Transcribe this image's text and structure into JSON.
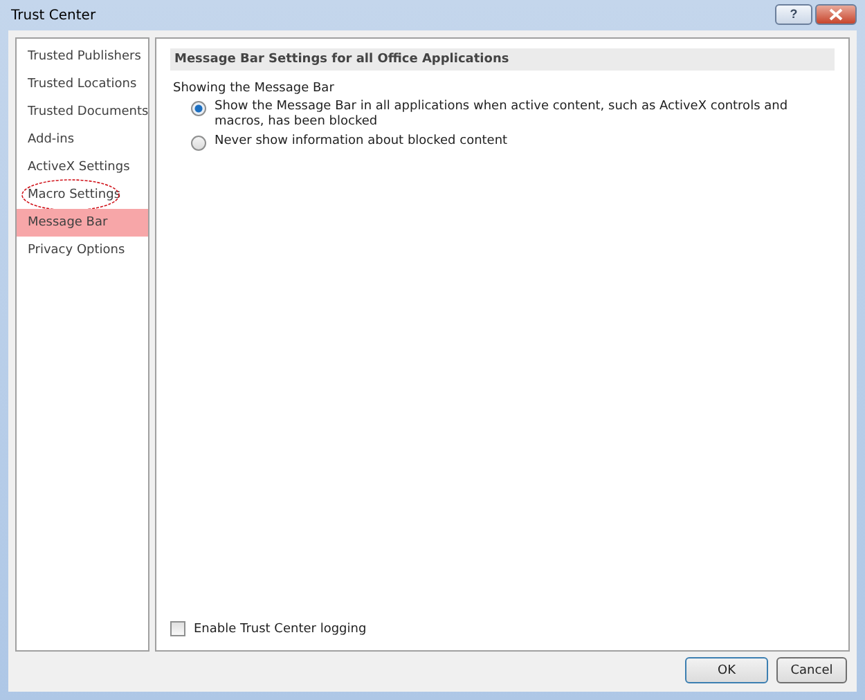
{
  "window": {
    "title": "Trust Center",
    "help_button": "?"
  },
  "sidebar": {
    "items": [
      {
        "label": "Trusted Publishers",
        "selected": false,
        "circled": false
      },
      {
        "label": "Trusted Locations",
        "selected": false,
        "circled": false
      },
      {
        "label": "Trusted Documents",
        "selected": false,
        "circled": false
      },
      {
        "label": "Add-ins",
        "selected": false,
        "circled": false
      },
      {
        "label": "ActiveX Settings",
        "selected": false,
        "circled": false
      },
      {
        "label": "Macro Settings",
        "selected": false,
        "circled": true
      },
      {
        "label": "Message Bar",
        "selected": true,
        "circled": false
      },
      {
        "label": "Privacy Options",
        "selected": false,
        "circled": false
      }
    ]
  },
  "section": {
    "heading": "Message Bar Settings for all Office Applications",
    "group_label": "Showing the Message Bar",
    "options": [
      {
        "label": "Show the Message Bar in all applications when active content, such as ActiveX controls and macros, has been blocked",
        "selected": true
      },
      {
        "label": "Never show information about blocked content",
        "selected": false
      }
    ]
  },
  "logging": {
    "label": "Enable Trust Center logging",
    "checked": false
  },
  "buttons": [
    {
      "label": "OK",
      "default": true
    },
    {
      "label": "Cancel",
      "default": false
    }
  ]
}
